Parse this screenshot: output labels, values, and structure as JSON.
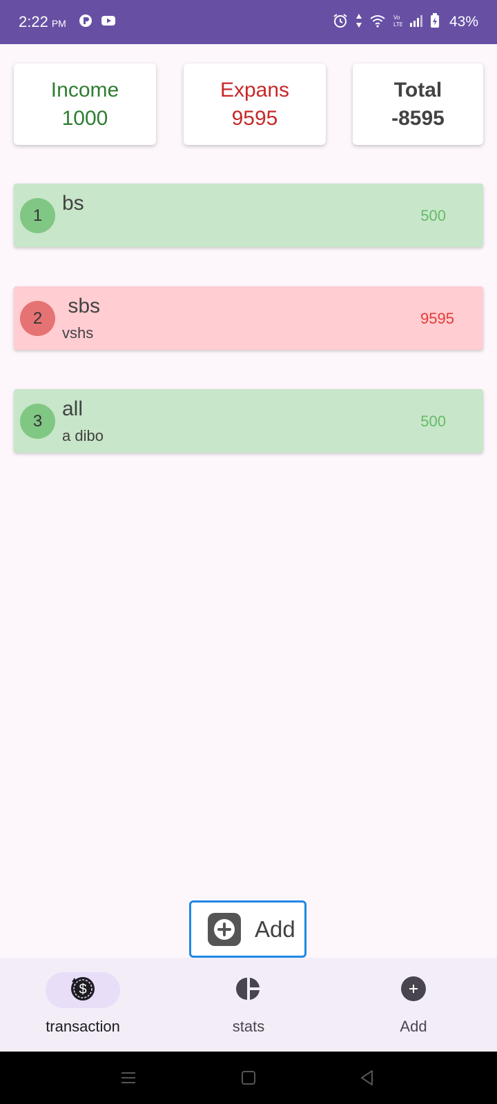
{
  "status_bar": {
    "time": "2:22",
    "ampm": "PM",
    "battery": "43%",
    "icons": [
      "p-app-icon",
      "youtube-icon",
      "alarm-icon",
      "data-arrows-icon",
      "wifi-icon",
      "volte-icon",
      "signal-icon",
      "battery-icon"
    ]
  },
  "summary": {
    "income_label": "Income",
    "income_value": "1000",
    "expense_label": "Expans",
    "expense_value": "9595",
    "total_label": "Total",
    "total_value": "-8595",
    "colors": {
      "income": "#2e7d32",
      "expense": "#c62828",
      "total": "#424242"
    }
  },
  "transactions": [
    {
      "index": "1",
      "title": "bs",
      "subtitle": "",
      "amount": "500",
      "type": "income"
    },
    {
      "index": "2",
      "title": " sbs",
      "subtitle": "vshs",
      "amount": "9595",
      "type": "expense"
    },
    {
      "index": "3",
      "title": "all",
      "subtitle": "a dibo",
      "amount": "500",
      "type": "income"
    }
  ],
  "fab": {
    "label": "Add",
    "icon": "plus-square-icon"
  },
  "bottom_nav": {
    "items": [
      {
        "label": "transaction",
        "icon": "dollar-history-icon",
        "active": true
      },
      {
        "label": "stats",
        "icon": "pie-chart-icon",
        "active": false
      },
      {
        "label": "Add",
        "icon": "add-circle-icon",
        "active": false
      }
    ]
  },
  "system_nav": {
    "icons": [
      "menu-icon",
      "home-icon",
      "back-icon"
    ]
  },
  "colors": {
    "status_bar": "#6750a4",
    "income_row": "#c8e6c9",
    "expense_row": "#ffcdd2",
    "fab_border": "#1e88e5",
    "nav_active_pill": "#e8def8"
  }
}
